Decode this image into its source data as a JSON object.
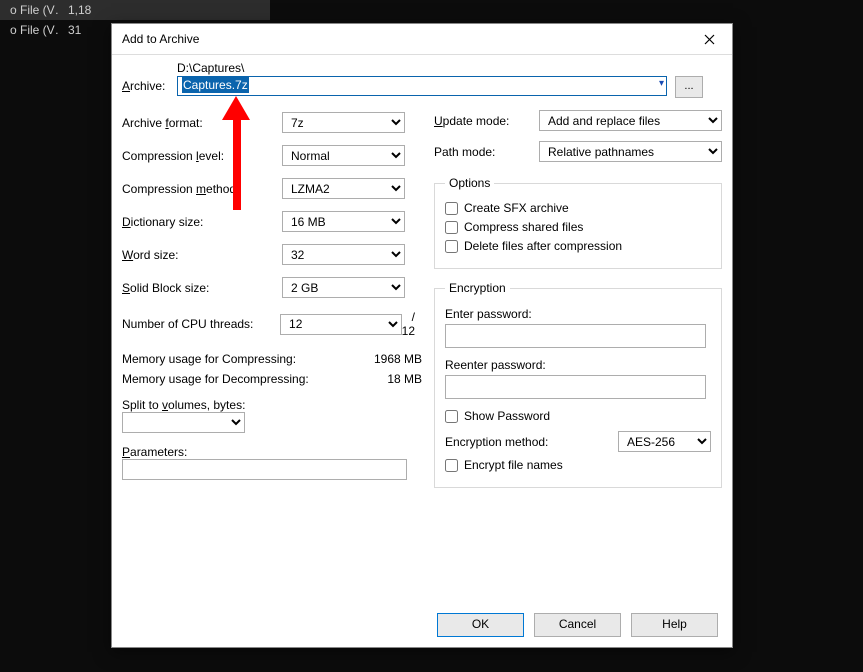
{
  "bg": {
    "rows": [
      {
        "name": "o File (V…",
        "size": "1,18"
      },
      {
        "name": "o File (V…",
        "size": "31"
      }
    ]
  },
  "dialog": {
    "title": "Add to Archive",
    "archive_label": "Archive:",
    "archive_underline": "A",
    "path": "D:\\Captures\\",
    "filename": "Captures.7z",
    "browse": "...",
    "left": {
      "format": {
        "label_pre": "Archive",
        "label_u": "f",
        "label_post": "ormat:",
        "value": "7z"
      },
      "level": {
        "label_pre": "Compression",
        "label_u": "l",
        "label_post": "evel:",
        "value": "Normal"
      },
      "method": {
        "label_pre": "Compression",
        "label_u": "m",
        "label_post": "ethod:",
        "value": "LZMA2"
      },
      "dict": {
        "label_u": "D",
        "label_post": "ictionary size:",
        "value": "16 MB"
      },
      "word": {
        "label_u": "W",
        "label_post": "ord size:",
        "value": "32"
      },
      "solid": {
        "label_u": "S",
        "label_post": "olid Block size:",
        "value": "2 GB"
      },
      "threads": {
        "label": "Number of CPU threads:",
        "value": "12",
        "total": "/ 12"
      },
      "mem_comp": {
        "label": "Memory usage for Compressing:",
        "value": "1968 MB"
      },
      "mem_decomp": {
        "label": "Memory usage for Decompressing:",
        "value": "18 MB"
      },
      "split": {
        "label_pre": "Split to",
        "label_u": "v",
        "label_post": "olumes, bytes:"
      },
      "params": {
        "label_pre": "",
        "label_u": "P",
        "label_post": "arameters:"
      }
    },
    "right": {
      "update": {
        "label_u": "U",
        "label_post": "pdate mode:",
        "value": "Add and replace files"
      },
      "pathmode": {
        "label": "Path mode:",
        "value": "Relative pathnames"
      },
      "options": {
        "legend": "Options",
        "sfx": "Create SFX archive",
        "shared": "Compress shared files",
        "delete": "Delete files after compression"
      },
      "enc": {
        "legend": "Encryption",
        "enter": "Enter password:",
        "reenter": "Reenter password:",
        "show": "Show Password",
        "method_label_pre": "Encryption method:",
        "method_value": "AES-256",
        "encrypt_names": "Encrypt file names"
      }
    },
    "buttons": {
      "ok": "OK",
      "cancel": "Cancel",
      "help": "Help"
    }
  }
}
